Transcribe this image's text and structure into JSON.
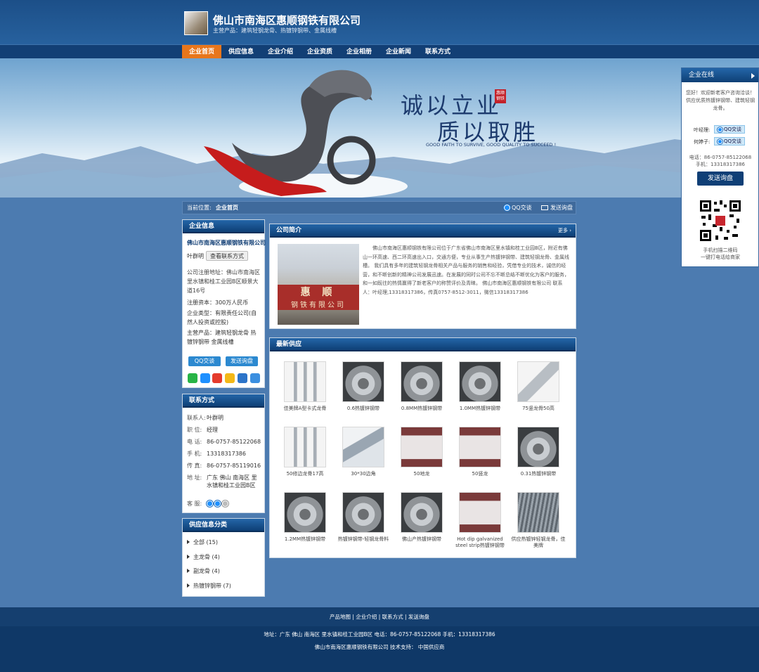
{
  "header": {
    "company": "佛山市南海区惠顺钢铁有限公司",
    "slogan": "主营产品：建筑轻钢龙骨、热镀锌钢带、金属线槽"
  },
  "nav": [
    {
      "label": "企业首页",
      "active": true
    },
    {
      "label": "供应信息"
    },
    {
      "label": "企业介绍"
    },
    {
      "label": "企业资质"
    },
    {
      "label": "企业相册"
    },
    {
      "label": "企业新闻"
    },
    {
      "label": "联系方式"
    }
  ],
  "banner": {
    "line1": "诚以立业",
    "line2": "质以取胜",
    "seal": "惠顺钢铁",
    "english": "GOOD FAITH TO SURVIVE, GOOD QUALITY TO SUCCEED !"
  },
  "crumb": {
    "label": "当前位置:",
    "current": "企业首页",
    "qq": "QQ交谈",
    "inquiry": "发送询盘"
  },
  "company_info": {
    "title": "企业信息",
    "name": "佛山市南海区惠顺钢铁有限公司",
    "contact": "叶群明",
    "contact_btn": "查看联系方式",
    "address": "公司注册地址：佛山市南海区里水镇和桂工业园B区顺景大道16号",
    "capital": "注册资本：300万人民币",
    "type": "企业类型：有限责任公司(自然人投资或控股)",
    "products": "主营产品：建筑轻钢龙骨 热镀锌钢带 金属线槽",
    "qq_btn": "QQ交谈",
    "inq_btn": "发送询盘"
  },
  "contact": {
    "title": "联系方式",
    "rows": [
      {
        "k": "联系人:",
        "v": "叶群明"
      },
      {
        "k": "职 位:",
        "v": "经理"
      },
      {
        "k": "电 话:",
        "v": "86-0757-85122068"
      },
      {
        "k": "手 机:",
        "v": "13318317386"
      },
      {
        "k": "传 真:",
        "v": "86-0757-85119016"
      },
      {
        "k": "地 址:",
        "v": "广东 佛山 南海区 里水镇和桂工业园B区"
      },
      {
        "k": "客 服:",
        "v": ""
      }
    ]
  },
  "categories": {
    "title": "供应信息分类",
    "items": [
      {
        "name": "全部",
        "count": "(15)"
      },
      {
        "name": "主龙骨",
        "count": "(4)"
      },
      {
        "name": "副龙骨",
        "count": "(4)"
      },
      {
        "name": "热镀锌钢带",
        "count": "(7)"
      }
    ]
  },
  "intro": {
    "title": "公司简介",
    "more": "更多",
    "image_text1": "惠  顺",
    "image_text2": "钢铁有限公司",
    "text": "佛山市南海区惠顺钢铁有限公司位于广东省佛山市南海区里水镇和桂工业园B区，附近有佛山一环高速、西二环高速出入口，交通方便，专业从事生产热镀锌钢带、建筑轻钢龙骨、金属线槽。 我们具有多年的建筑轻钢龙骨相关产品与服务的销售和经验，凭借专业的技术，诚信的经营，和不断创新的精神公司发展迅速。在发展的同时公司不忘不断总结不断优化为客户的服务，和一如既往的热情赢得了新老客户的称赞评价及青睐。 佛山市南海区惠顺钢铁有限公司 联系人：叶经理,13318317386，传真0757-8512-3011，微信13318317386"
  },
  "supply": {
    "title": "最新供应",
    "items": [
      {
        "name": "佳美牌A型卡式龙骨",
        "kind": "rail"
      },
      {
        "name": "0.6热镀锌钢带",
        "kind": "coil"
      },
      {
        "name": "0.8MM热镀锌钢带",
        "kind": "coil"
      },
      {
        "name": "1.0MM热镀锌钢带",
        "kind": "coil"
      },
      {
        "name": "75竖龙骨50高",
        "kind": "profile"
      },
      {
        "name": "50修边龙骨17高",
        "kind": "rail"
      },
      {
        "name": "30*30边角",
        "kind": "angle"
      },
      {
        "name": "50地龙",
        "kind": "pink"
      },
      {
        "name": "50竖龙",
        "kind": "pink"
      },
      {
        "name": "0.31热镀锌钢带",
        "kind": "coil"
      },
      {
        "name": "1.2MM热镀锌钢带",
        "kind": "coil"
      },
      {
        "name": "热镀锌钢带-轻钢龙骨料",
        "kind": "coil"
      },
      {
        "name": "佛山产热镀锌钢带",
        "kind": "coil"
      },
      {
        "name": "Hot dip galvanized steel strip热镀锌钢带",
        "kind": "pink"
      },
      {
        "name": "供应热镀锌轻钢龙骨，佳美牌",
        "kind": "stack"
      }
    ]
  },
  "side": {
    "title": "企业在线",
    "welcome": "您好！欢迎新老客户咨询洽谈！供应优质热镀锌钢带、建筑轻钢龙骨。",
    "p1": "叶经理:",
    "p2": "何婷子:",
    "qq": "QQ交谈",
    "tel": "电话：86-0757-85122068",
    "mobile": "手机：13318317386",
    "btn": "发送询盘",
    "qr1": "手机扫描二维码",
    "qr2": "一键打电话给商家"
  },
  "footer": {
    "links": "产品地图  |  企业介绍  |  联系方式  |  发送询盘",
    "address": "地址：广东 佛山 南海区 里水镇和桂工业园B区 电话：86-0757-85122068 手机：13318317386",
    "copy": "佛山市南海区惠顺钢铁有限公司  技术支持：  中国供应商"
  }
}
